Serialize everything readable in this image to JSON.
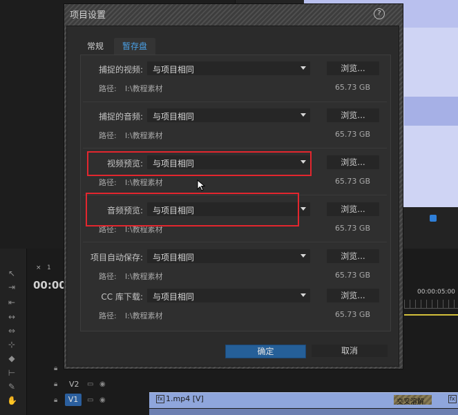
{
  "dialog": {
    "title": "项目设置",
    "help_glyph": "?",
    "tabs": [
      {
        "label": "常规",
        "active": false
      },
      {
        "label": "暂存盘",
        "active": true
      }
    ],
    "rows": [
      {
        "label": "捕捉的视频:",
        "value": "与项目相同",
        "browse": "浏览...",
        "path_label": "路径:",
        "path": "I:\\教程素材",
        "size": "65.73 GB"
      },
      {
        "label": "捕捉的音频:",
        "value": "与项目相同",
        "browse": "浏览...",
        "path_label": "路径:",
        "path": "I:\\教程素材",
        "size": "65.73 GB"
      },
      {
        "label": "视频预览:",
        "value": "与项目相同",
        "browse": "浏览...",
        "path_label": "路径:",
        "path": "I:\\教程素材",
        "size": "65.73 GB"
      },
      {
        "label": "音频预览:",
        "value": "与项目相同",
        "browse": "浏览...",
        "path_label": "路径:",
        "path": "I:\\教程素材",
        "size": "65.73 GB"
      },
      {
        "label": "项目自动保存:",
        "value": "与项目相同",
        "browse": "浏览...",
        "path_label": "路径:",
        "path": "I:\\教程素材",
        "size": "65.73 GB"
      },
      {
        "label": "CC 库下载:",
        "value": "与项目相同",
        "browse": "浏览...",
        "path_label": "路径:",
        "path": "I:\\教程素材",
        "size": "65.73 GB"
      }
    ],
    "ok_label": "确定",
    "cancel_label": "取消",
    "highlight_color": "#e4262e"
  },
  "background": {
    "timecode": "00:00",
    "ruler_time": "00:00:05:00",
    "tracks": [
      {
        "name": "V2"
      },
      {
        "name": "V1"
      }
    ],
    "clip_label": "1.mp4 [V]",
    "clip_fx": "fx",
    "clip_stripe_text": "交叉溶解",
    "panel_tab_close": "×",
    "panel_tab_num": "1",
    "preview_color": "#cfd4f4",
    "accent_blue": "#2b5f9e"
  }
}
